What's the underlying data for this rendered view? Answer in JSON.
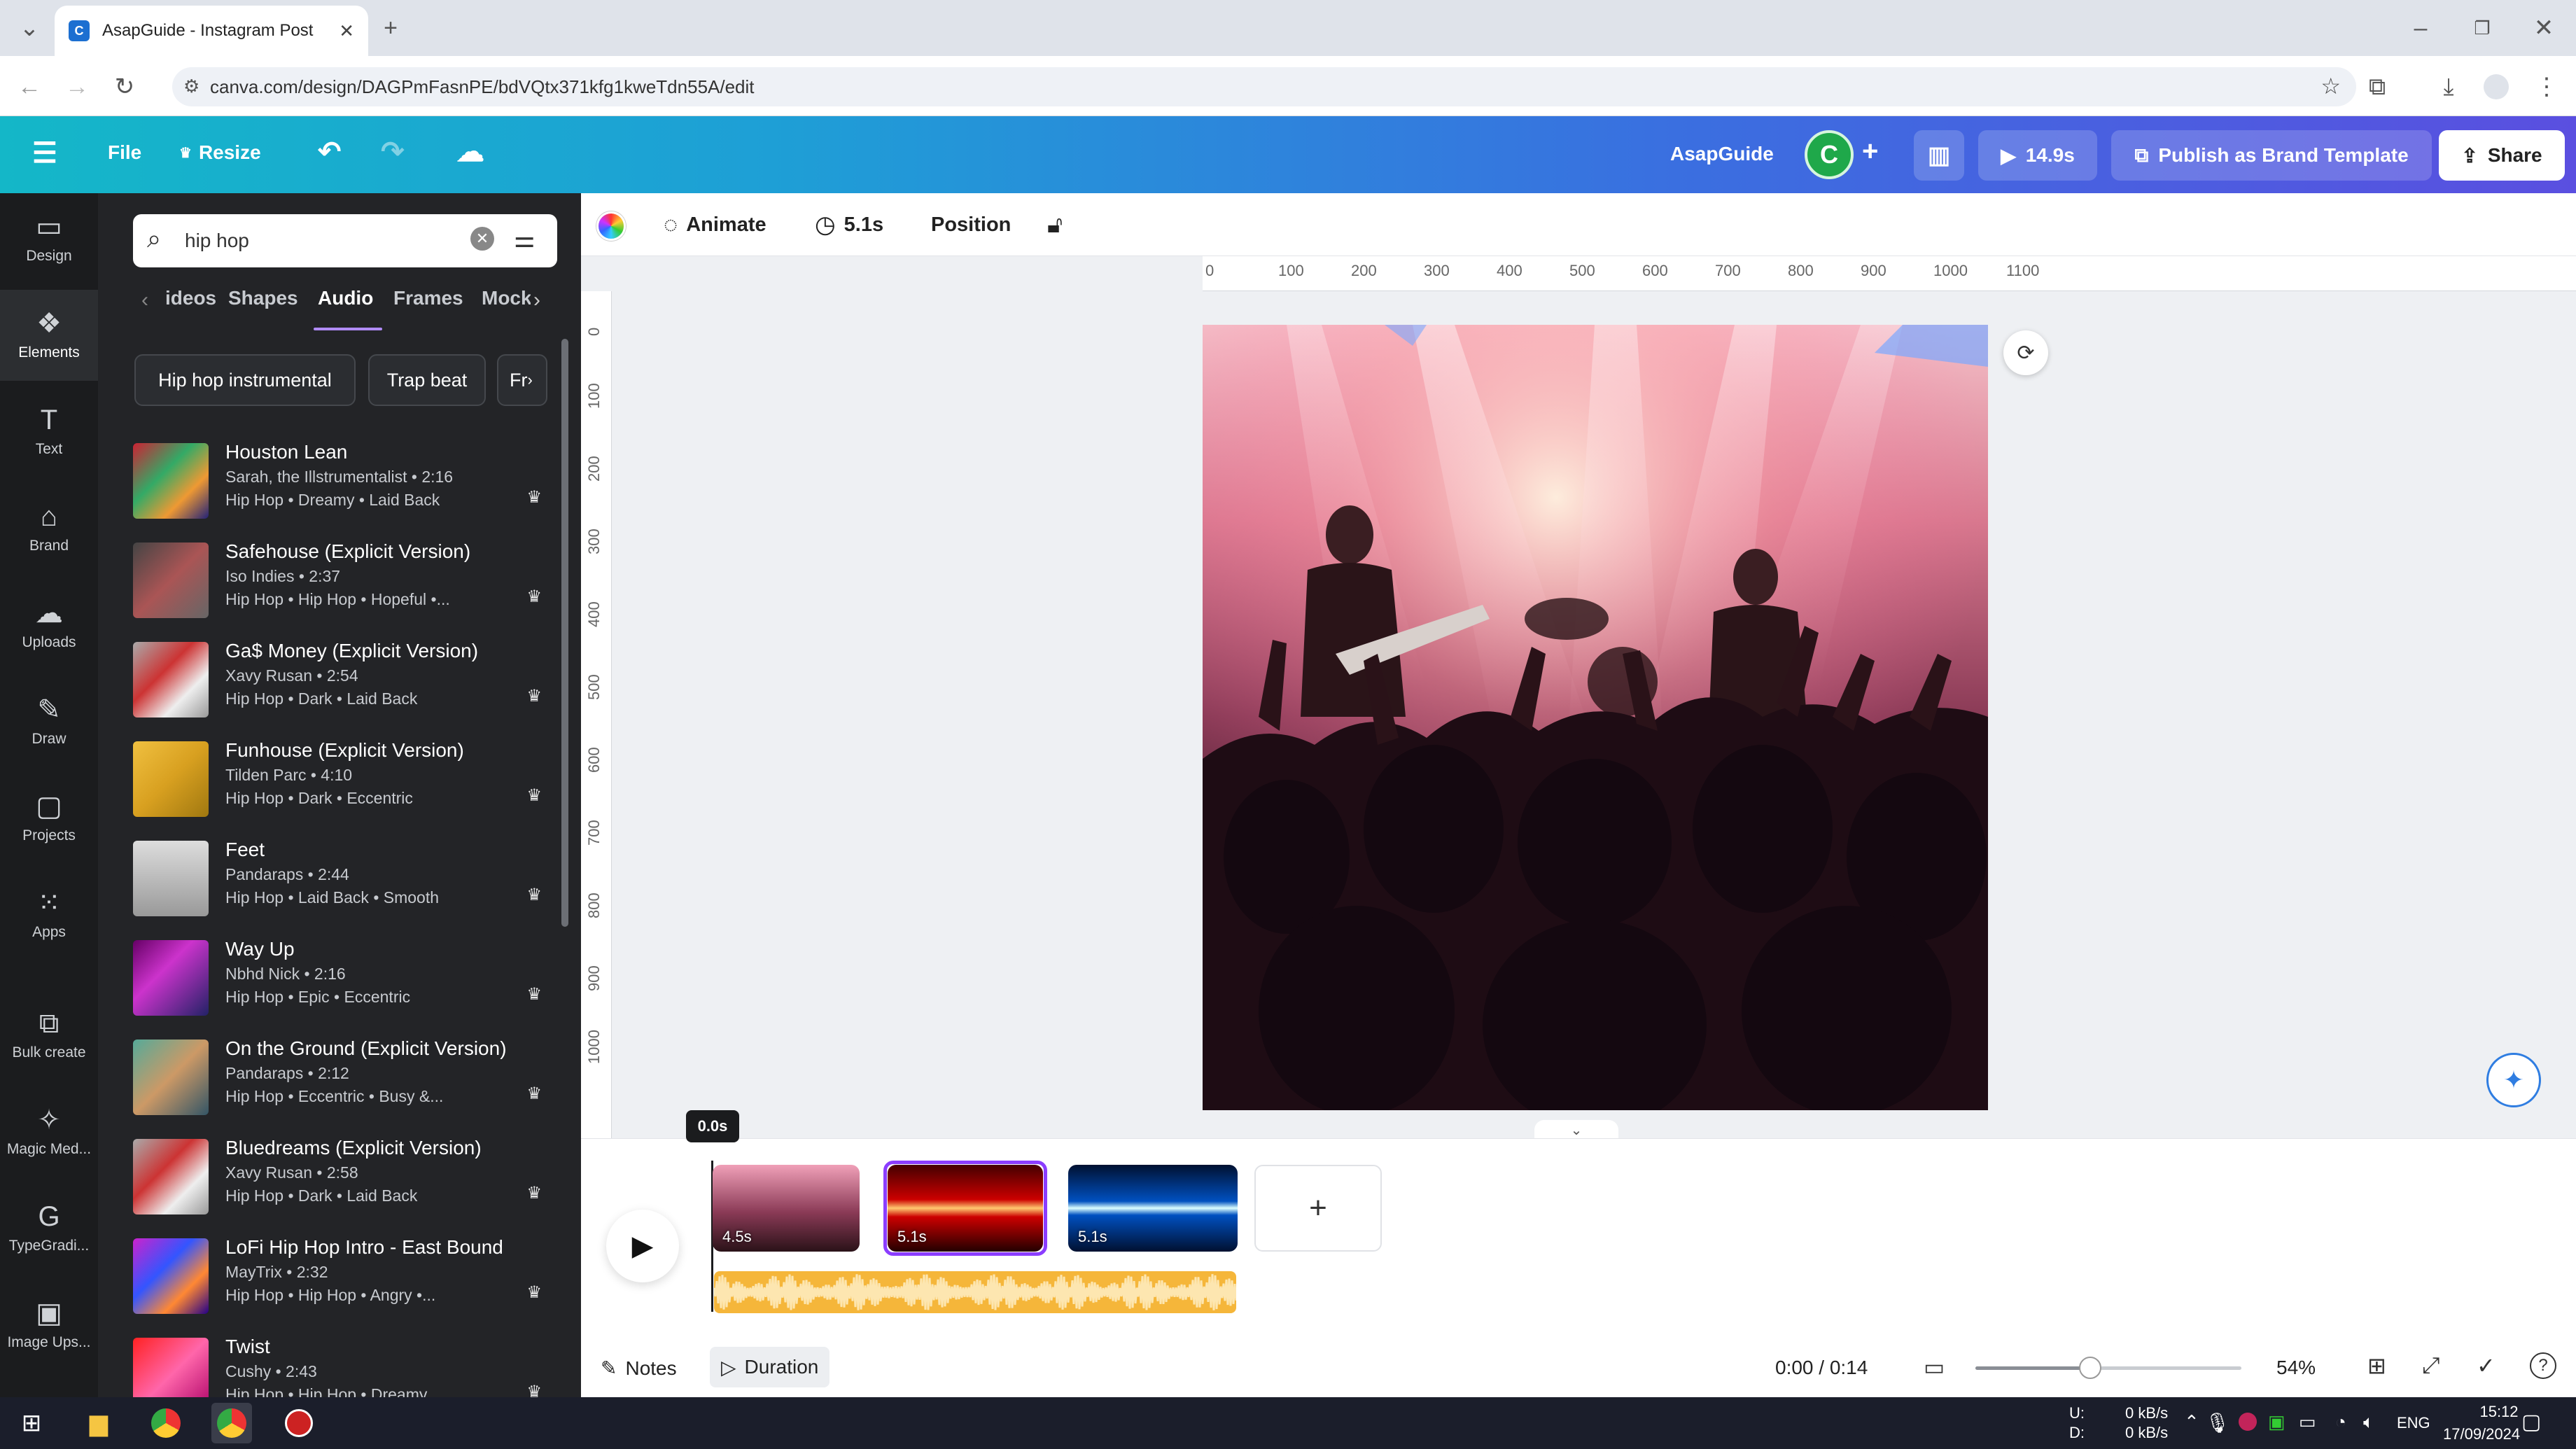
{
  "browser": {
    "tab_title": "AsapGuide - Instagram Post",
    "url": "canva.com/design/DAGPmFasnPE/bdVQtx371kfg1kweTdn55A/edit"
  },
  "header": {
    "file": "File",
    "resize": "Resize",
    "brand_name": "AsapGuide",
    "avatar_letter": "C",
    "play_duration": "14.9s",
    "publish": "Publish as Brand Template",
    "share": "Share"
  },
  "rail": [
    {
      "label": "Design",
      "icon": "▭"
    },
    {
      "label": "Elements",
      "icon": "❖"
    },
    {
      "label": "Text",
      "icon": "T"
    },
    {
      "label": "Brand",
      "icon": "⌂"
    },
    {
      "label": "Uploads",
      "icon": "☁"
    },
    {
      "label": "Draw",
      "icon": "✎"
    },
    {
      "label": "Projects",
      "icon": "▢"
    },
    {
      "label": "Apps",
      "icon": "⁙"
    },
    {
      "label": "Bulk create",
      "icon": "⧉"
    },
    {
      "label": "Magic Med...",
      "icon": "✧"
    },
    {
      "label": "TypeGradi...",
      "icon": "G"
    },
    {
      "label": "Image Ups...",
      "icon": "▣"
    }
  ],
  "panel": {
    "search_value": "hip hop",
    "tabs": [
      "ideos",
      "Shapes",
      "Audio",
      "Frames",
      "Mock"
    ],
    "chips": [
      "Hip hop instrumental",
      "Trap beat",
      "Fr"
    ],
    "tracks": [
      {
        "title": "Houston Lean",
        "sub": "Sarah, the Illstrumentalist • 2:16",
        "tags": "Hip Hop • Dreamy • Laid Back"
      },
      {
        "title": "Safehouse (Explicit Version)",
        "sub": "Iso Indies • 2:37",
        "tags": "Hip Hop • Hip Hop • Hopeful •..."
      },
      {
        "title": "Ga$ Money (Explicit Version)",
        "sub": "Xavy Rusan • 2:54",
        "tags": "Hip Hop • Dark • Laid Back"
      },
      {
        "title": "Funhouse (Explicit Version)",
        "sub": "Tilden Parc • 4:10",
        "tags": "Hip Hop • Dark • Eccentric"
      },
      {
        "title": "Feet",
        "sub": "Pandaraps • 2:44",
        "tags": "Hip Hop • Laid Back • Smooth"
      },
      {
        "title": "Way Up",
        "sub": "Nbhd Nick • 2:16",
        "tags": "Hip Hop • Epic • Eccentric"
      },
      {
        "title": "On the Ground (Explicit Version)",
        "sub": "Pandaraps • 2:12",
        "tags": "Hip Hop • Eccentric • Busy &..."
      },
      {
        "title": "Bluedreams (Explicit Version)",
        "sub": "Xavy Rusan • 2:58",
        "tags": "Hip Hop • Dark • Laid Back"
      },
      {
        "title": "LoFi Hip Hop Intro - East Bound",
        "sub": "MayTrix • 2:32",
        "tags": "Hip Hop • Hip Hop • Angry •..."
      },
      {
        "title": "Twist",
        "sub": "Cushy • 2:43",
        "tags": "Hip Hop • Hip Hop • Dreamy"
      }
    ]
  },
  "toolbar": {
    "animate": "Animate",
    "duration": "5.1s",
    "position": "Position"
  },
  "ruler_h": [
    "0",
    "100",
    "200",
    "300",
    "400",
    "500",
    "600",
    "700",
    "800",
    "900",
    "1000",
    "1100"
  ],
  "ruler_v": [
    "0",
    "100",
    "200",
    "300",
    "400",
    "500",
    "600",
    "700",
    "800",
    "900",
    "1000"
  ],
  "timeline": {
    "playhead_time": "0.0s",
    "clips": [
      "4.5s",
      "5.1s",
      "5.1s"
    ],
    "notes": "Notes",
    "duration_btn": "Duration",
    "time": "0:00 / 0:14",
    "zoom": "54%"
  },
  "taskbar": {
    "net_up": "0 kB/s",
    "net_down": "0 kB/s",
    "net_u": "U:",
    "net_d": "D:",
    "lang": "ENG",
    "clock": "15:12",
    "date": "17/09/2024"
  },
  "colors": {
    "accent": "#8b3dff",
    "header_start": "#14b7c8",
    "header_end": "#5a4fe0",
    "panel_bg": "#232427"
  }
}
